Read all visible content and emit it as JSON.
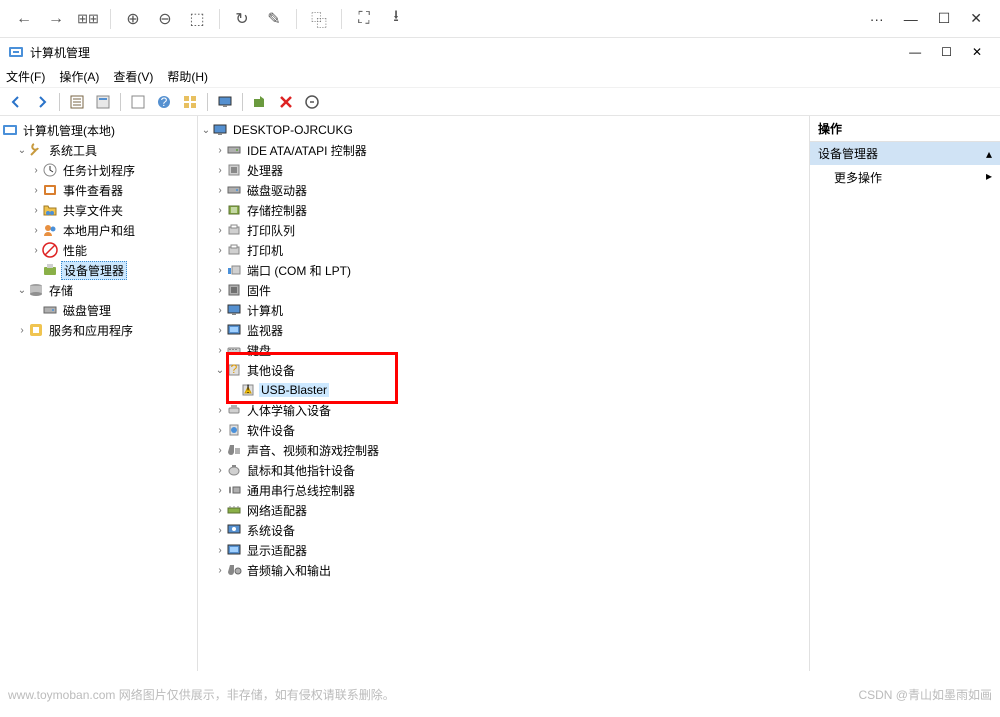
{
  "browser": {
    "more": "···"
  },
  "mmc": {
    "title": "计算机管理",
    "menu": {
      "file": "文件(F)",
      "action": "操作(A)",
      "view": "查看(V)",
      "help": "帮助(H)"
    }
  },
  "left_tree": {
    "root": "计算机管理(本地)",
    "system_tools": "系统工具",
    "task_scheduler": "任务计划程序",
    "event_viewer": "事件查看器",
    "shared_folders": "共享文件夹",
    "local_users": "本地用户和组",
    "performance": "性能",
    "device_manager": "设备管理器",
    "storage": "存储",
    "disk_mgmt": "磁盘管理",
    "services_apps": "服务和应用程序"
  },
  "mid_tree": {
    "computer": "DESKTOP-OJRCUKG",
    "items": [
      "IDE ATA/ATAPI 控制器",
      "处理器",
      "磁盘驱动器",
      "存储控制器",
      "打印队列",
      "打印机",
      "端口 (COM 和 LPT)",
      "固件",
      "计算机",
      "监视器",
      "键盘",
      "其他设备",
      "人体学输入设备",
      "软件设备",
      "声音、视频和游戏控制器",
      "鼠标和其他指针设备",
      "通用串行总线控制器",
      "网络适配器",
      "系统设备",
      "显示适配器",
      "音频输入和输出"
    ],
    "usb_blaster": "USB-Blaster"
  },
  "right": {
    "header": "操作",
    "section": "设备管理器",
    "more": "更多操作"
  },
  "footer": {
    "left": "www.toymoban.com  网络图片仅供展示，非存储，如有侵权请联系删除。",
    "right": "CSDN @青山如墨雨如画"
  }
}
